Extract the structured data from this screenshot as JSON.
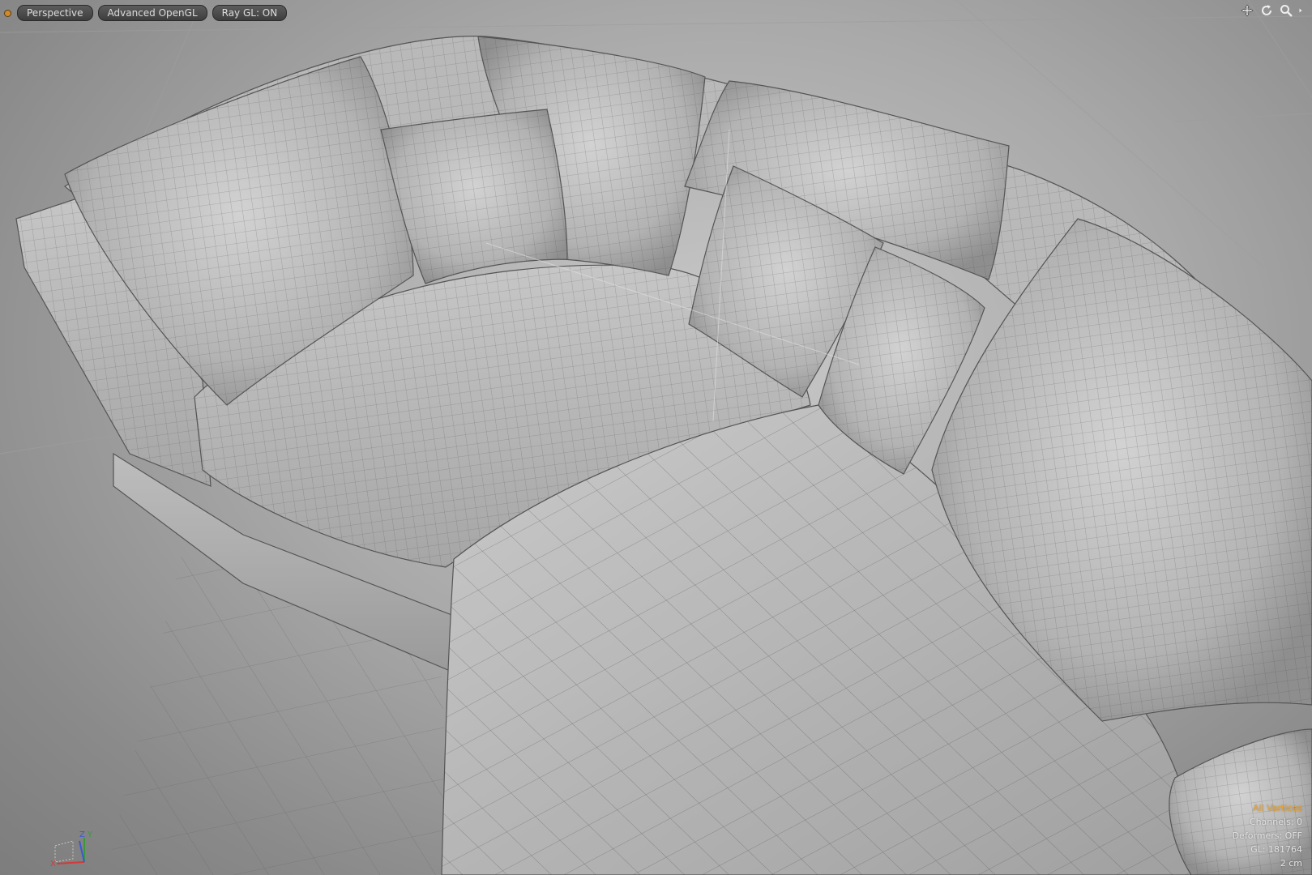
{
  "toolbar": {
    "status_dot_color": "#d08a2a",
    "view_mode": "Perspective",
    "render_mode": "Advanced OpenGL",
    "ray_gl": "Ray GL: ON"
  },
  "viewport_icons": [
    "move-icon",
    "rotate-icon",
    "zoom-icon",
    "expand-arrow-icon"
  ],
  "hud": {
    "selection_mode": "All Vertices",
    "channels": "Channels: 0",
    "deformers": "Deformers: OFF",
    "gl": "GL: 181764",
    "scale": "2 cm",
    "accent_color": "#e6a33a"
  },
  "axis_gizmo": {
    "x_label": "X",
    "y_label": "Y",
    "z_label": "Z"
  },
  "scene": {
    "object": "sectional-sofa-wireframe",
    "wire_color": "#555555",
    "shade_color": "#c8c8c8"
  }
}
